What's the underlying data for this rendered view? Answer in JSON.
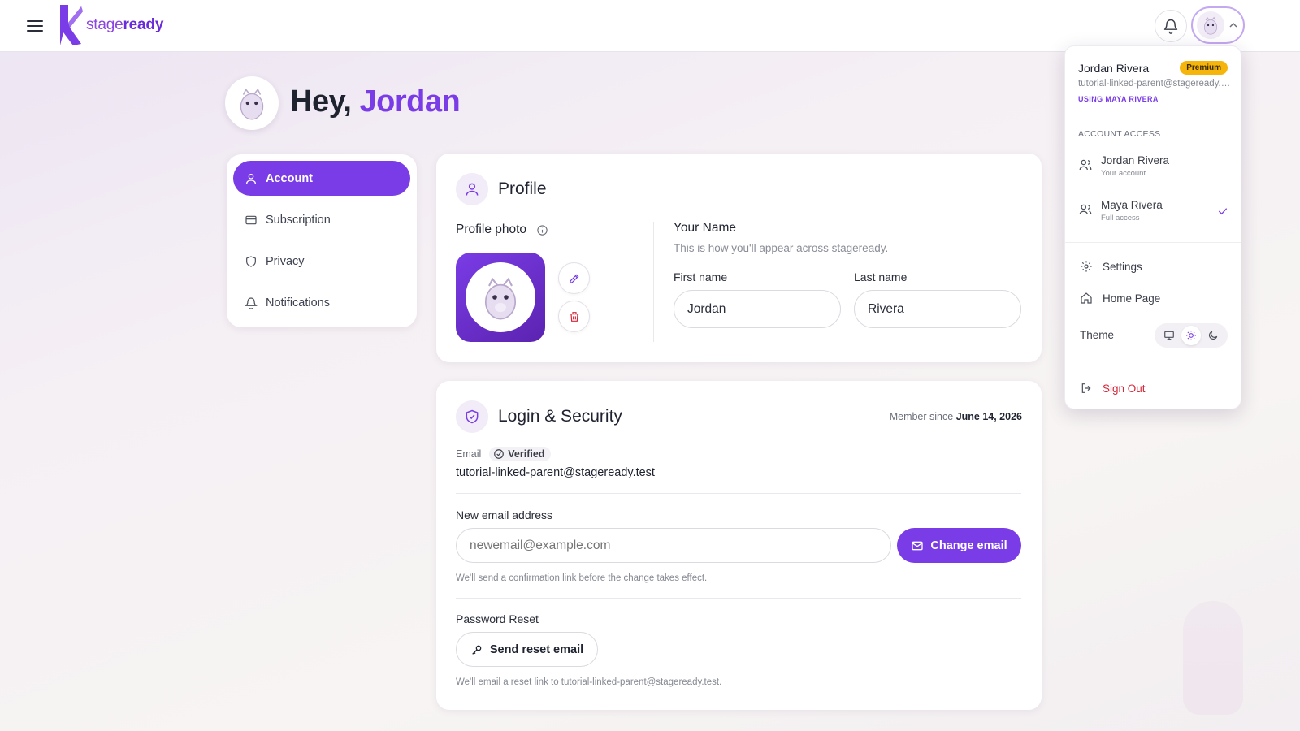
{
  "brand": {
    "name_part1": "stage",
    "name_part2": "ready"
  },
  "greeting": {
    "hello": "Hey, ",
    "name": "Jordan"
  },
  "sidenav": {
    "items": [
      {
        "label": "Account",
        "icon": "user-icon",
        "active": true
      },
      {
        "label": "Subscription",
        "icon": "credit-card-icon",
        "active": false
      },
      {
        "label": "Privacy",
        "icon": "shield-icon",
        "active": false
      },
      {
        "label": "Notifications",
        "icon": "bell-icon",
        "active": false
      }
    ]
  },
  "profile": {
    "title": "Profile",
    "photo_label": "Profile photo",
    "your_name_title": "Your Name",
    "your_name_subtitle": "This is how you'll appear across stageready.",
    "first_name_label": "First name",
    "first_name_value": "Jordan",
    "last_name_label": "Last name",
    "last_name_value": "Rivera"
  },
  "security": {
    "title": "Login & Security",
    "member_since_label": "Member since",
    "member_since_date": "June 14, 2026",
    "email_label": "Email",
    "verified_label": "Verified",
    "email_value": "tutorial-linked-parent@stageready.test",
    "new_email_label": "New email address",
    "new_email_placeholder": "newemail@example.com",
    "change_email_button": "Change email",
    "change_email_hint": "We'll send a confirmation link before the change takes effect.",
    "password_reset_label": "Password Reset",
    "send_reset_button": "Send reset email",
    "reset_hint": "We'll email a reset link to tutorial-linked-parent@stageready.test."
  },
  "dropdown": {
    "user_name": "Jordan Rivera",
    "badge": "Premium",
    "user_email": "tutorial-linked-parent@stageready.test",
    "using_as": "USING MAYA RIVERA",
    "section_title": "ACCOUNT ACCESS",
    "accounts": [
      {
        "name": "Jordan Rivera",
        "role": "Your account",
        "selected": false
      },
      {
        "name": "Maya Rivera",
        "role": "Full access",
        "selected": true
      }
    ],
    "settings_label": "Settings",
    "home_label": "Home Page",
    "theme_label": "Theme",
    "theme_selected": "light",
    "sign_out_label": "Sign Out"
  },
  "colors": {
    "accent": "#7a3ce6",
    "premium": "#f5b50a",
    "danger": "#d3283a"
  }
}
